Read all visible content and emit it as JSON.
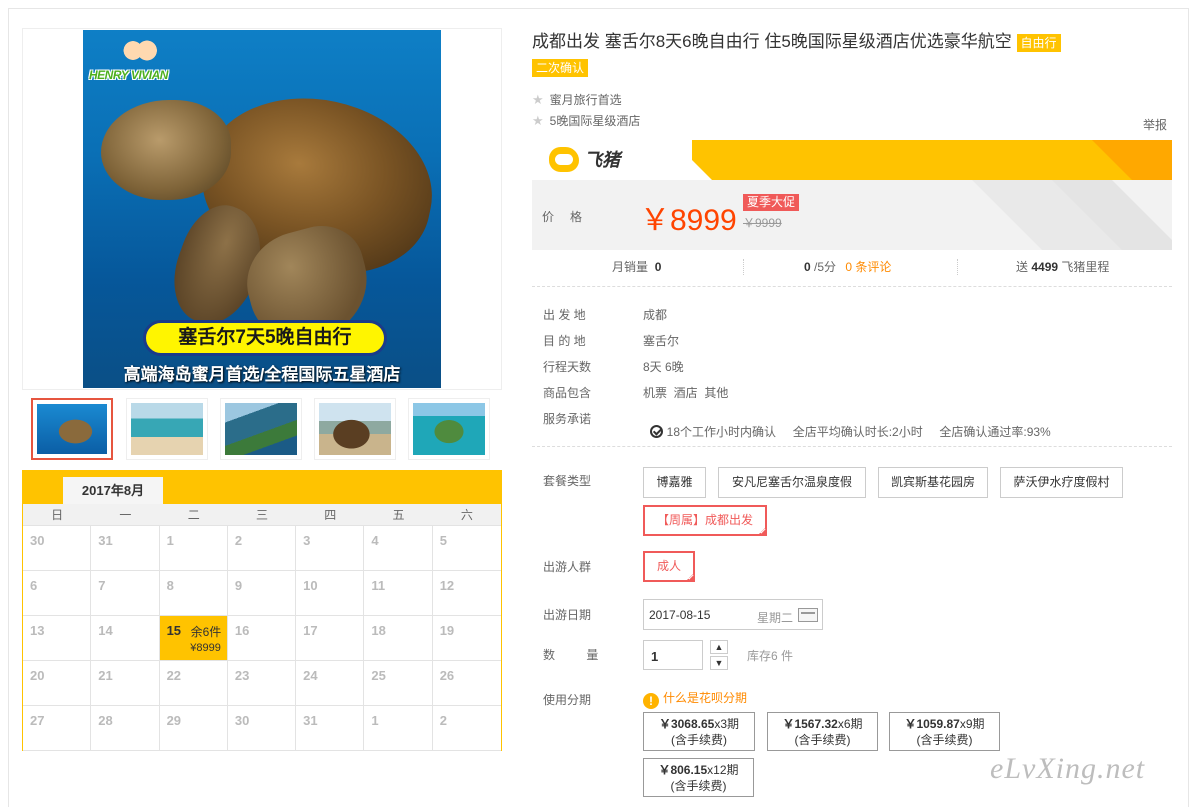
{
  "product": {
    "title": "成都出发 塞舌尔8天6晚自由行 住5晚国际星级酒店优选豪华航空",
    "tag_type": "自由行",
    "tag_confirm": "二次确认",
    "features": [
      "蜜月旅行首选",
      "5晚国际星级酒店"
    ],
    "report": "举报"
  },
  "main_image": {
    "logo_text": "HENRY VIVIAN",
    "banner": "塞舌尔7天5晚自由行",
    "subtitle": "高端海岛蜜月首选/全程国际五星酒店"
  },
  "thumbnails": [
    {
      "name": "turtle",
      "active": true
    },
    {
      "name": "beach-rocks",
      "active": false
    },
    {
      "name": "island-coast",
      "active": false
    },
    {
      "name": "giant-tortoise",
      "active": false
    },
    {
      "name": "resort-island",
      "active": false
    }
  ],
  "brand": {
    "name": "飞猪"
  },
  "price": {
    "label": "价格",
    "value": "￥8999",
    "promo": "夏季大促",
    "original": "￥9999"
  },
  "stats": {
    "monthly_label": "月销量",
    "monthly_value": "0",
    "score_value": "0",
    "score_suffix": "/5分",
    "reviews": "0 条评论",
    "points_prefix": "送",
    "points_value": "4499",
    "points_suffix": "飞猪里程"
  },
  "info": [
    {
      "label": "出 发 地",
      "value": "成都"
    },
    {
      "label": "目 的 地",
      "value": "塞舌尔"
    },
    {
      "label": "行程天数",
      "value": "8天 6晚"
    },
    {
      "label": "商品包含",
      "value": "机票  酒店  其他"
    },
    {
      "label": "服务承诺",
      "value": "18个工作小时内确认     全店平均确认时长:2小时     全店确认通过率:93%"
    }
  ],
  "options": {
    "package_label": "套餐类型",
    "packages": [
      "博嘉雅",
      "安凡尼塞舌尔温泉度假",
      "凯宾斯基花园房",
      "萨沃伊水疗度假村",
      "【周属】成都出发"
    ],
    "group_label": "出游人群",
    "groups": [
      "成人"
    ],
    "date_label": "出游日期",
    "date_value": "2017-08-15",
    "date_weekday": "星期二",
    "qty_label": "数 量",
    "qty_value": "1",
    "qty_up": "▲",
    "qty_down": "▼",
    "stock": "库存6 件",
    "install_label": "使用分期",
    "install_link": "什么是花呗分期",
    "install_icon": "!",
    "installments": [
      {
        "amount": "￥3068.65",
        "period": "x3期",
        "fee": "(含手续费)"
      },
      {
        "amount": "￥1567.32",
        "period": "x6期",
        "fee": "(含手续费)"
      },
      {
        "amount": "￥1059.87",
        "period": "x9期",
        "fee": "(含手续费)"
      },
      {
        "amount": "￥806.15",
        "period": "x12期",
        "fee": "(含手续费)"
      }
    ]
  },
  "calendar": {
    "month": "2017年8月",
    "weekdays": [
      "日",
      "一",
      "二",
      "三",
      "四",
      "五",
      "六"
    ],
    "days": [
      "30",
      "31",
      "1",
      "2",
      "3",
      "4",
      "5",
      "6",
      "7",
      "8",
      "9",
      "10",
      "11",
      "12",
      "13",
      "14",
      "15",
      "16",
      "17",
      "18",
      "19",
      "20",
      "21",
      "22",
      "23",
      "24",
      "25",
      "26",
      "27",
      "28",
      "29",
      "30",
      "31",
      "1",
      "2"
    ],
    "selected_day": "15",
    "selected_rest": "余6件",
    "selected_price": "¥8999"
  },
  "watermark": "eLvXing.net",
  "colors": {
    "accent": "#ffc300",
    "price": "#ff4400",
    "promo": "#f05a59",
    "link": "#ff8a00"
  }
}
